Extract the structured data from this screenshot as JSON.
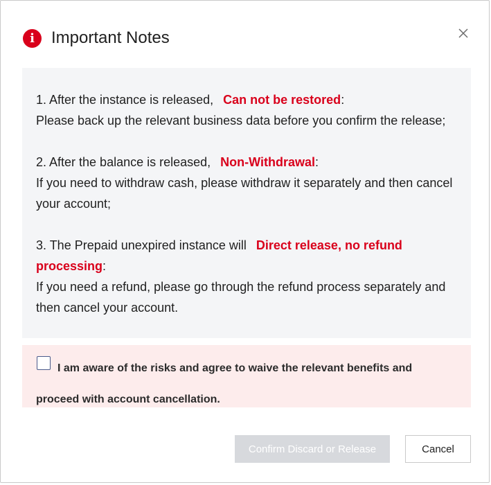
{
  "dialog": {
    "title": "Important Notes",
    "title_icon": "alert-info-icon",
    "close_icon": "close-icon"
  },
  "notes": [
    {
      "prefix": "1. After the instance is released,",
      "highlight": "Can not be restored",
      "colon": ":",
      "body": "Please back up the relevant business data before you confirm the release;"
    },
    {
      "prefix": "2. After the balance is released,",
      "highlight": "Non-Withdrawal",
      "colon": ":",
      "body": "If you need to withdraw cash, please withdraw it separately and then cancel your account;"
    },
    {
      "prefix": "3. The Prepaid unexpired instance will",
      "highlight": "Direct release, no refund processing",
      "colon": ":",
      "body": "If you need a refund, please go through the refund process separately and then cancel your account."
    }
  ],
  "agreement": {
    "checked": false,
    "label": "I am aware of the risks and agree to waive the relevant benefits and proceed with account cancellation."
  },
  "buttons": {
    "confirm_label": "Confirm Discard or Release",
    "confirm_enabled": false,
    "cancel_label": "Cancel"
  },
  "colors": {
    "accent_red": "#d9001b",
    "notes_bg": "#f4f5f7",
    "agree_bg": "#fdecec",
    "disabled_button": "#d7d9dd"
  }
}
